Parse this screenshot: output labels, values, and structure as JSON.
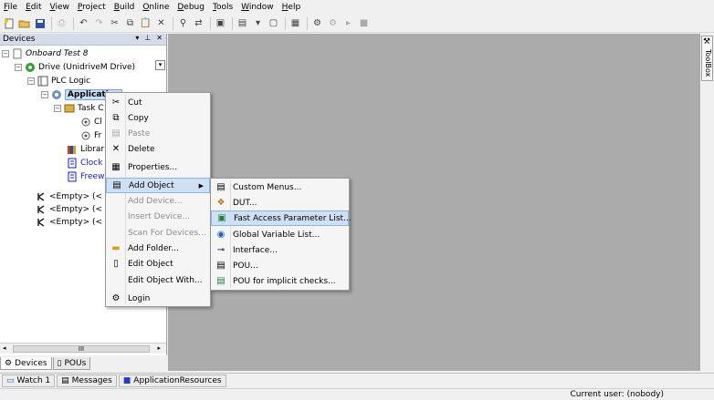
{
  "menubar": [
    "File",
    "Edit",
    "View",
    "Project",
    "Build",
    "Online",
    "Debug",
    "Tools",
    "Window",
    "Help"
  ],
  "devices_panel": {
    "title": "Devices",
    "tree": [
      {
        "label": "Onboard Test 8",
        "italic": true
      },
      {
        "label": "Drive (UnidriveM Drive)"
      },
      {
        "label": "PLC Logic"
      },
      {
        "label": "Application"
      },
      {
        "label": "Task C"
      },
      {
        "label": "Cl"
      },
      {
        "label": "Fr"
      },
      {
        "label": "Librar"
      },
      {
        "label": "Clock"
      },
      {
        "label": "Freewh"
      },
      {
        "label": "<Empty> (<"
      },
      {
        "label": "<Empty> (<"
      },
      {
        "label": "<Empty> (<"
      }
    ],
    "scroll_thumb": "III",
    "tabs": [
      "Devices",
      "POUs"
    ]
  },
  "toolbox_label": "ToolBox",
  "context_menu": [
    {
      "label": "Cut",
      "icon": "scissors-icon",
      "enabled": true
    },
    {
      "label": "Copy",
      "icon": "copy-icon",
      "enabled": true
    },
    {
      "label": "Paste",
      "icon": "paste-icon",
      "enabled": false
    },
    {
      "label": "Delete",
      "icon": "delete-icon",
      "enabled": true
    },
    {
      "label": "Properties...",
      "icon": "properties-icon",
      "enabled": true
    },
    {
      "label": "Add Object",
      "icon": "add-object-icon",
      "enabled": true,
      "submenu": true
    },
    {
      "label": "Add Device...",
      "enabled": false
    },
    {
      "label": "Insert Device...",
      "enabled": false
    },
    {
      "label": "Scan For Devices...",
      "enabled": false
    },
    {
      "label": "Add Folder...",
      "icon": "folder-icon",
      "enabled": true
    },
    {
      "label": "Edit Object",
      "icon": "edit-object-icon",
      "enabled": true
    },
    {
      "label": "Edit Object With...",
      "enabled": true
    },
    {
      "label": "Login",
      "icon": "login-icon",
      "enabled": true
    }
  ],
  "submenu": [
    {
      "label": "Custom Menus...",
      "icon": "custom-menu-icon"
    },
    {
      "label": "DUT...",
      "icon": "dut-icon"
    },
    {
      "label": "Fast Access Parameter List...",
      "icon": "parameter-list-icon",
      "highlighted": true
    },
    {
      "label": "Global Variable List...",
      "icon": "globe-icon"
    },
    {
      "label": "Interface...",
      "icon": "interface-icon"
    },
    {
      "label": "POU...",
      "icon": "pou-icon"
    },
    {
      "label": "POU for implicit checks...",
      "icon": "pou-check-icon"
    }
  ],
  "bottom_tabs": [
    "Watch 1",
    "Messages",
    "ApplicationResources"
  ],
  "status": {
    "user": "Current user: (nobody)"
  }
}
